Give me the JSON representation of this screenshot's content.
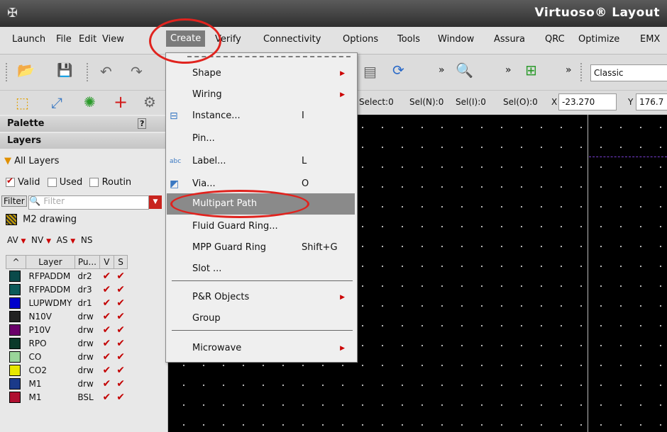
{
  "window": {
    "title": "Virtuoso® Layout"
  },
  "menubar": {
    "items": [
      "Launch",
      "File",
      "Edit",
      "View",
      "Create",
      "Verify",
      "Connectivity",
      "Options",
      "Tools",
      "Window",
      "Assura",
      "QRC",
      "Optimize",
      "EMX"
    ]
  },
  "toolbar": {
    "workspace_value": "Classic",
    "sel_all": "Select:0",
    "sel_n": "Sel(N):0",
    "sel_i": "Sel(I):0",
    "sel_o": "Sel(O):0",
    "x_label": "X",
    "x_value": "-23.270",
    "y_label": "Y",
    "y_value": "176.7"
  },
  "palette": {
    "header": "Palette",
    "layers_header": "Layers",
    "all_layers": "All Layers",
    "valid_label": "Valid",
    "used_label": "Used",
    "routing_label": "Routin",
    "filter_label": "Filter",
    "filter_placeholder": "Filter",
    "current_layer": "M2 drawing",
    "filters": [
      "AV",
      "NV",
      "AS",
      "NS"
    ],
    "columns": [
      "Layer",
      "Pu...",
      "V",
      "S"
    ],
    "rows": [
      {
        "layer": "RFPADDM",
        "purpose": "dr2",
        "color": "#0a4a4a"
      },
      {
        "layer": "RFPADDM",
        "purpose": "dr3",
        "color": "#0a5a5a"
      },
      {
        "layer": "LUPWDMY",
        "purpose": "dr1",
        "color": "#0000cc"
      },
      {
        "layer": "N10V",
        "purpose": "drw",
        "color": "#222222"
      },
      {
        "layer": "P10V",
        "purpose": "drw",
        "color": "#6a006a"
      },
      {
        "layer": "RPO",
        "purpose": "drw",
        "color": "#0a3a2a"
      },
      {
        "layer": "CO",
        "purpose": "drw",
        "color": "#9ad69a"
      },
      {
        "layer": "CO2",
        "purpose": "drw",
        "color": "#e8e800"
      },
      {
        "layer": "M1",
        "purpose": "drw",
        "color": "#1a3a8a"
      },
      {
        "layer": "M1",
        "purpose": "BSL",
        "color": "#b01030"
      }
    ]
  },
  "create_menu": {
    "items": [
      {
        "label": "Shape",
        "accel": "",
        "submenu": true
      },
      {
        "label": "Wiring",
        "accel": "",
        "submenu": true
      },
      {
        "label": "Instance...",
        "accel": "I",
        "submenu": false
      },
      {
        "label": "Pin...",
        "accel": "",
        "submenu": false
      },
      {
        "label": "Label...",
        "accel": "L",
        "submenu": false
      },
      {
        "label": "Via...",
        "accel": "O",
        "submenu": false
      },
      {
        "label": "Multipart Path",
        "accel": "",
        "submenu": false
      },
      {
        "label": "Fluid Guard Ring...",
        "accel": "",
        "submenu": false
      },
      {
        "label": "MPP Guard Ring",
        "accel": "Shift+G",
        "submenu": false
      },
      {
        "label": "Slot ...",
        "accel": "",
        "submenu": false
      },
      {
        "label": "P&R Objects",
        "accel": "",
        "submenu": true
      },
      {
        "label": "Group",
        "accel": "",
        "submenu": false
      },
      {
        "label": "Microwave",
        "accel": "",
        "submenu": true
      }
    ]
  },
  "colors": {
    "annotation": "#e0231e",
    "highlight": "#8a8a8a"
  }
}
